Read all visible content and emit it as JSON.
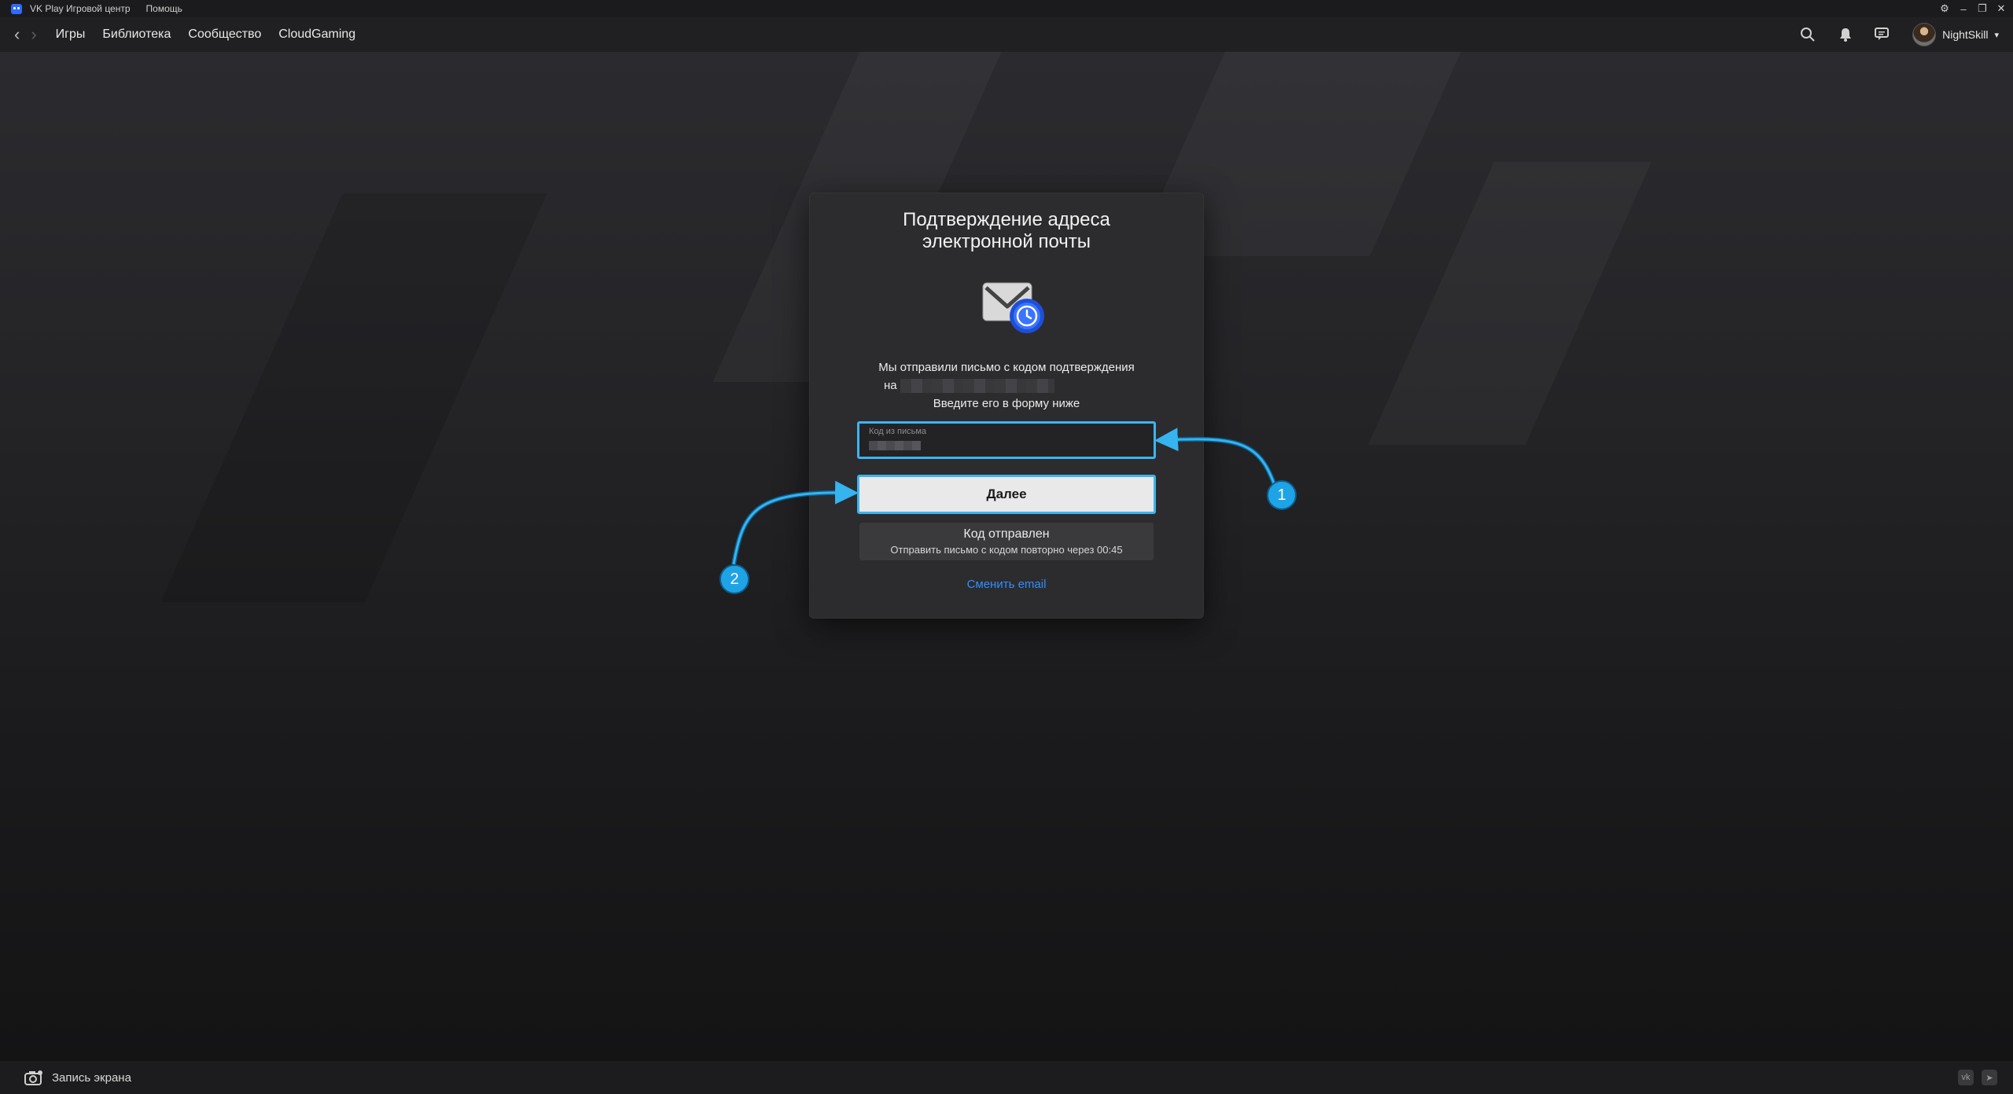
{
  "titlebar": {
    "app_name": "VK Play Игровой центр",
    "help": "Помощь"
  },
  "navbar": {
    "links": [
      "Игры",
      "Библиотека",
      "Сообщество",
      "CloudGaming"
    ],
    "username": "NightSkill"
  },
  "dialog": {
    "title_line1": "Подтверждение адреса",
    "title_line2": "электронной почты",
    "text_line1": "Мы отправили письмо с кодом подтверждения",
    "text_line2_prefix": "на",
    "text_line3": "Введите его в форму ниже",
    "code_label": "Код из письма",
    "next_button": "Далее",
    "resend_title": "Код отправлен",
    "resend_sub": "Отправить письмо с кодом повторно через 00:45",
    "change_email": "Сменить email"
  },
  "annotations": {
    "badge1": "1",
    "badge2": "2"
  },
  "statusbar": {
    "record_label": "Запись экрана"
  },
  "colors": {
    "accent": "#3fb3ee",
    "link": "#2f8fff",
    "badge": "#1ea4e6"
  }
}
